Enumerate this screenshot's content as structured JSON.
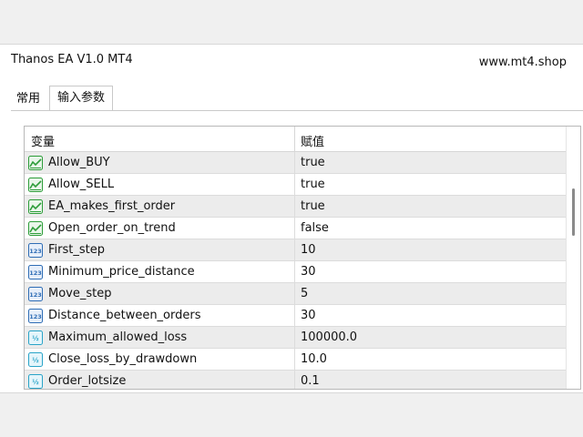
{
  "window": {
    "title": "Thanos EA V1.0 MT4",
    "site": "www.mt4.shop"
  },
  "tabs": [
    {
      "label": "常用",
      "active": false
    },
    {
      "label": "输入参数",
      "active": true
    }
  ],
  "table": {
    "headers": {
      "variable": "变量",
      "value": "赋值"
    },
    "rows": [
      {
        "icon": "bool-icon",
        "name": "Allow_BUY",
        "value": "true"
      },
      {
        "icon": "bool-icon",
        "name": "Allow_SELL",
        "value": "true"
      },
      {
        "icon": "bool-icon",
        "name": "EA_makes_first_order",
        "value": "true"
      },
      {
        "icon": "bool-icon",
        "name": "Open_order_on_trend",
        "value": "false"
      },
      {
        "icon": "integer-icon",
        "name": "First_step",
        "value": "10"
      },
      {
        "icon": "integer-icon",
        "name": "Minimum_price_distance",
        "value": "30"
      },
      {
        "icon": "integer-icon",
        "name": "Move_step",
        "value": "5"
      },
      {
        "icon": "integer-icon",
        "name": "Distance_between_orders",
        "value": "30"
      },
      {
        "icon": "double-icon",
        "name": "Maximum_allowed_loss",
        "value": "100000.0"
      },
      {
        "icon": "double-icon",
        "name": "Close_loss_by_drawdown",
        "value": "10.0"
      },
      {
        "icon": "double-icon",
        "name": "Order_lotsize",
        "value": "0.1"
      }
    ]
  },
  "colors": {
    "bool_icon": "#2e9d3a",
    "integer_icon": "#2f6db5",
    "double_icon": "#2aa4c8",
    "row_alt": "#ececec"
  }
}
